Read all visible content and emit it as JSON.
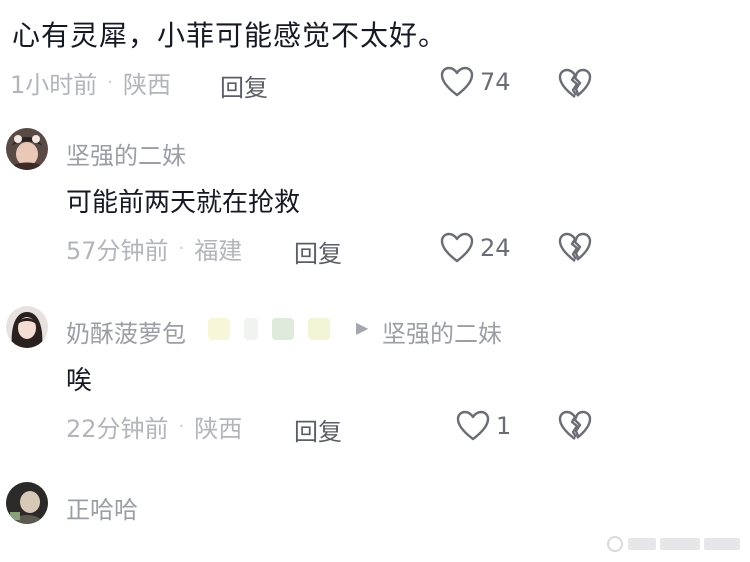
{
  "top_comment": {
    "text": "心有灵犀，小菲可能感觉不太好。",
    "time": "1小时前",
    "location": "陕西",
    "reply_label": "回复",
    "like_count": "74"
  },
  "comments": [
    {
      "username": "坚强的二妹",
      "text": "可能前两天就在抢救",
      "time": "57分钟前",
      "location": "福建",
      "reply_label": "回复",
      "like_count": "24"
    },
    {
      "username": "奶酥菠萝包",
      "reply_to": "坚强的二妹",
      "text": "唉",
      "time": "22分钟前",
      "location": "陕西",
      "reply_label": "回复",
      "like_count": "1"
    },
    {
      "username": "正哈哈"
    }
  ],
  "icons": {
    "like": "heart-outline-icon",
    "dislike": "broken-heart-icon",
    "reply_arrow": "triangle-right-icon"
  },
  "colors": {
    "text_primary": "#161823",
    "text_secondary": "#a5a7ad",
    "background": "#ffffff"
  }
}
